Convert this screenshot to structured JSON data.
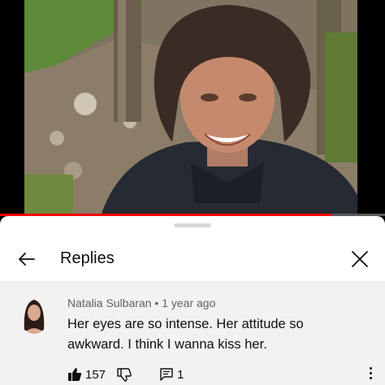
{
  "video": {
    "progress": 0.86
  },
  "replies": {
    "title": "Replies",
    "back_icon": "arrow-left-icon",
    "close_icon": "close-icon"
  },
  "comment": {
    "author": "Natalia Sulbaran",
    "separator": "•",
    "time": "1 year ago",
    "text": "Her eyes are so intense. Her attitude so awkward. I think I wanna kiss her.",
    "likes": "157",
    "reply_count": "1",
    "like_icon": "thumbs-up-icon",
    "dislike_icon": "thumbs-down-icon",
    "reply_icon": "reply-icon",
    "more_icon": "more-vertical-icon"
  },
  "colors": {
    "progress_red": "#ff0000",
    "sheet_bg": "#ffffff",
    "comment_bg": "#f2f2f2",
    "meta_text": "#606060"
  }
}
